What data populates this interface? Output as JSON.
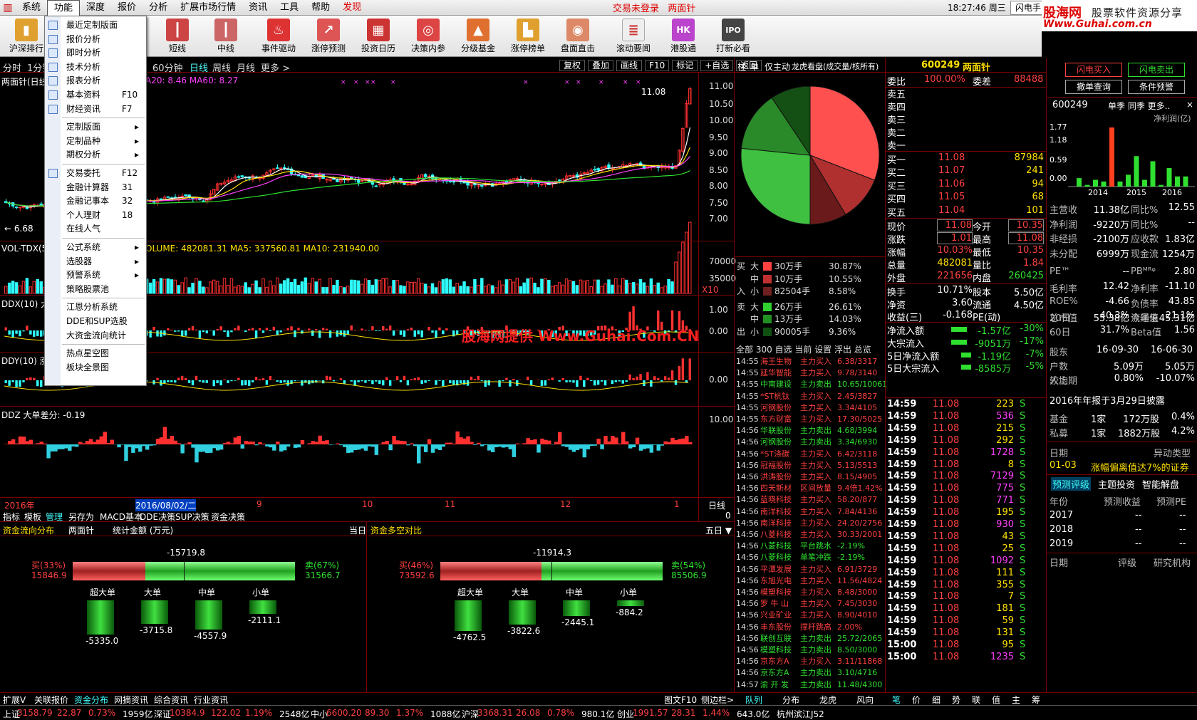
{
  "menu": [
    "系统",
    "功能",
    "深度",
    "报价",
    "分析",
    "扩展市场行情",
    "资讯",
    "工具",
    "帮助",
    "发现"
  ],
  "status_login": "交易未登录",
  "status_stock": "两面针",
  "clock": "18:27:46 周三",
  "flash_btn": "闪电手",
  "brand": {
    "a": "股海网",
    "b": "股票软件资源分享",
    "c": "Www.Guhai.com.cn"
  },
  "toolbar": [
    "沪深排行",
    "短线",
    "中线",
    "事件驱动",
    "涨停预测",
    "投资日历",
    "决策内参",
    "分级基金",
    "涨停榜单",
    "盘面直击",
    "滚动要闻",
    "港股通",
    "打新必看"
  ],
  "period_tabs": [
    "分时",
    "1分钟",
    "60分钟",
    "日线",
    "周线",
    "月线",
    "更多 >"
  ],
  "chart_tools": [
    "复权",
    "叠加",
    "画线",
    "F10",
    "标记",
    "+自选",
    "返回"
  ],
  "dropdown": {
    "items": [
      {
        "t": "最近定制版面",
        "k": "",
        "arrow": false
      },
      {
        "t": "报价分析",
        "k": "",
        "arrow": false
      },
      {
        "t": "即时分析",
        "k": "",
        "arrow": false
      },
      {
        "t": "技术分析",
        "k": "",
        "arrow": false
      },
      {
        "t": "报表分析",
        "k": "",
        "arrow": false
      },
      {
        "t": "基本资料",
        "k": "F10",
        "arrow": false
      },
      {
        "t": "财经资讯",
        "k": "F7",
        "arrow": false
      },
      {
        "t": "定制版面",
        "k": "",
        "arrow": true
      },
      {
        "t": "定制品种",
        "k": "",
        "arrow": true
      },
      {
        "t": "期权分析",
        "k": "",
        "arrow": true
      },
      {
        "t": "交易委托",
        "k": "F12",
        "arrow": false
      },
      {
        "t": "金融计算器",
        "k": "31",
        "arrow": false
      },
      {
        "t": "金融记事本",
        "k": "32",
        "arrow": false
      },
      {
        "t": "个人理财",
        "k": "18",
        "arrow": false
      },
      {
        "t": "在线人气",
        "k": "",
        "arrow": false
      },
      {
        "t": "公式系统",
        "k": "",
        "arrow": true
      },
      {
        "t": "选股器",
        "k": "",
        "arrow": true
      },
      {
        "t": "预警系统",
        "k": "",
        "arrow": true
      },
      {
        "t": "策略股票池",
        "k": "",
        "arrow": false
      },
      {
        "t": "江恩分析系统",
        "k": "",
        "arrow": false
      },
      {
        "t": "DDE和SUP选股",
        "k": "",
        "arrow": false
      },
      {
        "t": "大资金流向统计",
        "k": "",
        "arrow": false
      },
      {
        "t": "热点星空图",
        "k": "",
        "arrow": false
      },
      {
        "t": "板块全景图",
        "k": "",
        "arrow": false
      }
    ]
  },
  "chart": {
    "title_main": "两面针(日线",
    "ma_legend": "A20: 8.46  MA60: 8.27",
    "high_label": "11.08",
    "low_label": "6.68",
    "price_axis": [
      "11.00",
      "10.50",
      "10.00",
      "9.50",
      "9.00",
      "8.50",
      "8.00",
      "7.50",
      "7.00"
    ],
    "vol_title": "VOL-TDX(5",
    "vol_legend": "OLUME: 482081.31  MA5: 337560.81  MA10: 231940.00",
    "vol_axis": [
      "70000",
      "35000",
      "X10"
    ],
    "ddx_title": "DDX(10) 大",
    "ddx_axis": [
      "1.00",
      "0.00"
    ],
    "ddy_title": "DDY(10) 涨跌动因",
    "ddy_axis": [
      "0.00"
    ],
    "ddz_title": "DDZ 大单差分: -0.19",
    "ddz_axis": [
      "10.00"
    ],
    "watermark": "股海网提供 Www.Guhai.Com.CN",
    "time_axis": [
      "2016年",
      "2016/08/02/二",
      "9",
      "10",
      "11",
      "12",
      "1"
    ],
    "period_label": "日线",
    "panel_value": "0"
  },
  "indicator_tabs": [
    "指标",
    "模板",
    "管理",
    "另存为",
    "MACD基本",
    "DDE决策",
    "SUP决策",
    "资金决策"
  ],
  "bottom": {
    "left_title": "资金流向分布",
    "left_stock": "两面针",
    "left_unit": "统计金额 (万元)",
    "left_period": "当日",
    "right_title": "资金多空对比",
    "right_period": "五日 ▼",
    "left_net": "-15719.8",
    "left_buy": "买(33%)",
    "left_buy_v": "15846.9",
    "left_sell": "卖(67%)",
    "left_sell_v": "31566.7",
    "right_net": "-11914.3",
    "right_buy": "买(46%)",
    "right_buy_v": "73592.6",
    "right_sell": "卖(54%)",
    "right_sell_v": "85506.9",
    "left_bars": [
      {
        "n": "超大单",
        "v": "-5335.0"
      },
      {
        "n": "大单",
        "v": "-3715.8"
      },
      {
        "n": "中单",
        "v": "-4557.9"
      },
      {
        "n": "小单",
        "v": "-2111.1"
      }
    ],
    "right_bars": [
      {
        "n": "超大单",
        "v": "-4762.5"
      },
      {
        "n": "大单",
        "v": "-3822.6"
      },
      {
        "n": "中单",
        "v": "-2445.1"
      },
      {
        "n": "小单",
        "v": "-884.2"
      }
    ]
  },
  "pie_tabs": [
    "柱",
    "单",
    "仅主动",
    "龙虎看盘(成交量/核所有)"
  ],
  "pie_data": [
    30.87,
    10.55,
    8.58,
    26.61,
    14.03,
    9.36
  ],
  "flow": [
    {
      "side": "买",
      "size": "大",
      "amount": "30万手",
      "pct": "30.87%",
      "color": "#ff4040"
    },
    {
      "side": "",
      "size": "中",
      "amount": "10万手",
      "pct": "10.55%",
      "color": "#c03030"
    },
    {
      "side": "入",
      "size": "小",
      "amount": "82504手",
      "pct": "8.58%",
      "color": "#702020"
    },
    {
      "side": "卖",
      "size": "大",
      "amount": "26万手",
      "pct": "26.61%",
      "color": "#30d030"
    },
    {
      "side": "",
      "size": "中",
      "amount": "13万手",
      "pct": "14.03%",
      "color": "#209020"
    },
    {
      "side": "出",
      "size": "小",
      "amount": "90005手",
      "pct": "9.36%",
      "color": "#105010"
    }
  ],
  "rt_tabs": "全部  300  自选  当前  设置  浮出  总览",
  "rt_list": [
    [
      "14:55",
      "海王生物",
      "主力买入",
      "6.38/3317",
      "r"
    ],
    [
      "14:55",
      "延华智能",
      "主力买入",
      "9.78/3140",
      "r"
    ],
    [
      "14:55",
      "中南建设",
      "主力卖出",
      "10.65/10061",
      "g"
    ],
    [
      "14:55",
      "*ST杭钛",
      "主力买入",
      "2.45/3827",
      "r"
    ],
    [
      "14:55",
      "河钢股份",
      "主力买入",
      "3.34/4105",
      "r"
    ],
    [
      "14:55",
      "东方财富",
      "主力买入",
      "17.30/5025",
      "r"
    ],
    [
      "14:56",
      "华联股份",
      "主力卖出",
      "4.68/3994",
      "g"
    ],
    [
      "14:56",
      "河钢股份",
      "主力卖出",
      "3.34/6930",
      "g"
    ],
    [
      "14:56",
      "*ST涤碳",
      "主力买入",
      "6.42/3118",
      "r"
    ],
    [
      "14:56",
      "冠福股份",
      "主力买入",
      "5.13/5513",
      "r"
    ],
    [
      "14:56",
      "洪涛股份",
      "主力买入",
      "8.15/4905",
      "r"
    ],
    [
      "14:56",
      "四天新材",
      "区间放量",
      "9.4倍1.42%",
      "r"
    ],
    [
      "14:56",
      "蓝晓科技",
      "主力买入",
      "58.20/877",
      "r"
    ],
    [
      "14:56",
      "南洋科技",
      "主力买入",
      "7.84/4136",
      "r"
    ],
    [
      "14:56",
      "南洋科技",
      "主力买入",
      "24.20/2756",
      "r"
    ],
    [
      "14:56",
      "八菱科技",
      "主力买入",
      "30.33/2001",
      "r"
    ],
    [
      "14:56",
      "八菱科技",
      "平台跳水",
      "-2.19%",
      "g"
    ],
    [
      "14:56",
      "八菱科技",
      "单笔冲跌",
      "-2.19%",
      "g"
    ],
    [
      "14:56",
      "平潭发展",
      "主力买入",
      "6.91/3729",
      "r"
    ],
    [
      "14:56",
      "东旭光电",
      "主力买入",
      "11.56/4824",
      "r"
    ],
    [
      "14:56",
      "模塑科技",
      "主力买入",
      "8.48/3000",
      "r"
    ],
    [
      "14:56",
      "罗 牛 山",
      "主力买入",
      "7.45/3030",
      "r"
    ],
    [
      "14:56",
      "兴业矿业",
      "主力买入",
      "8.90/4010",
      "r"
    ],
    [
      "14:56",
      "丰东股份",
      "撑杆跳高",
      "2.00%",
      "r"
    ],
    [
      "14:56",
      "联创互联",
      "主力卖出",
      "25.72/2065",
      "g"
    ],
    [
      "14:56",
      "模塑科技",
      "主力卖出",
      "8.50/3000",
      "g"
    ],
    [
      "14:56",
      "京东方A",
      "主力买入",
      "3.11/11868",
      "r"
    ],
    [
      "14:56",
      "京东方A",
      "主力卖出",
      "3.10/4716",
      "g"
    ],
    [
      "14:57",
      "渝 开 发",
      "主力卖出",
      "11.48/4300",
      "g"
    ]
  ],
  "quote": {
    "code": "600249",
    "name": "两面针",
    "webi_l": "委比",
    "webi_v": "100.00%",
    "weicha_l": "委差",
    "weicha_v": "88488",
    "sells": [
      "卖五",
      "卖四",
      "卖三",
      "卖二",
      "卖一"
    ],
    "buys": [
      {
        "l": "买一",
        "p": "11.08",
        "v": "87984"
      },
      {
        "l": "买二",
        "p": "11.07",
        "v": "241"
      },
      {
        "l": "买三",
        "p": "11.06",
        "v": "94"
      },
      {
        "l": "买四",
        "p": "11.05",
        "v": "68"
      },
      {
        "l": "买五",
        "p": "11.04",
        "v": "101"
      }
    ],
    "stats": [
      [
        "现价",
        "11.08",
        "今开",
        "10.35"
      ],
      [
        "涨跌",
        "1.01",
        "最高",
        "11.08"
      ],
      [
        "涨幅",
        "10.03%",
        "最低",
        "10.35"
      ],
      [
        "总量",
        "482081",
        "量比",
        "1.84"
      ],
      [
        "外盘",
        "221656",
        "内盘",
        "260425"
      ]
    ],
    "stats2": [
      [
        "换手",
        "10.71%",
        "股本",
        "5.50亿"
      ],
      [
        "净资",
        "3.60",
        "流通",
        "4.50亿"
      ],
      [
        "收益(三)",
        "-0.168",
        "PE(动)",
        ""
      ]
    ],
    "netflow": [
      [
        "净流入额",
        "-1.57亿",
        "-30%"
      ],
      [
        "大宗流入",
        "-9051万",
        "-17%"
      ],
      [
        "5日净流入额",
        "-1.19亿",
        "-7%"
      ],
      [
        "5日大宗流入",
        "-8585万",
        "-5%"
      ]
    ],
    "ticks": [
      [
        "14:59",
        "11.08",
        "223",
        "S"
      ],
      [
        "14:59",
        "11.08",
        "536",
        "S"
      ],
      [
        "14:59",
        "11.08",
        "215",
        "S"
      ],
      [
        "14:59",
        "11.08",
        "292",
        "S"
      ],
      [
        "14:59",
        "11.08",
        "1728",
        "S"
      ],
      [
        "14:59",
        "11.08",
        "8",
        "S"
      ],
      [
        "14:59",
        "11.08",
        "7129",
        "S"
      ],
      [
        "14:59",
        "11.08",
        "775",
        "S"
      ],
      [
        "14:59",
        "11.08",
        "771",
        "S"
      ],
      [
        "14:59",
        "11.08",
        "195",
        "S"
      ],
      [
        "14:59",
        "11.08",
        "930",
        "S"
      ],
      [
        "14:59",
        "11.08",
        "43",
        "S"
      ],
      [
        "14:59",
        "11.08",
        "25",
        "S"
      ],
      [
        "14:59",
        "11.08",
        "1092",
        "S"
      ],
      [
        "14:59",
        "11.08",
        "111",
        "S"
      ],
      [
        "14:59",
        "11.08",
        "355",
        "S"
      ],
      [
        "14:59",
        "11.08",
        "7",
        "S"
      ],
      [
        "14:59",
        "11.08",
        "181",
        "S"
      ],
      [
        "14:59",
        "11.08",
        "59",
        "S"
      ],
      [
        "14:59",
        "11.08",
        "131",
        "S"
      ],
      [
        "15:00",
        "11.08",
        "95",
        "S"
      ],
      [
        "15:00",
        "11.08",
        "1235",
        "S"
      ]
    ]
  },
  "f10": {
    "buttons": [
      "闪电买入",
      "闪电卖出",
      "撤单查询",
      "条件预警"
    ],
    "code": "600249",
    "tabs": "单季  同季  更多..",
    "chart_unit": "净利润(亿)",
    "chart_axis": [
      "1.77",
      "1.18",
      "0.59",
      "0.00"
    ],
    "years": [
      "2014",
      "2015",
      "2016"
    ],
    "rows": [
      [
        "主营收",
        "11.38亿",
        "同比%",
        "12.55"
      ],
      [
        "净利润",
        "-9220万",
        "同比%",
        "--"
      ],
      [
        "非经损",
        "-2100万",
        "应收款",
        "1.83亿"
      ],
      [
        "未分配",
        "6999万",
        "现金流",
        "1254万"
      ],
      [
        "PE™",
        "--",
        "PBᴹᴿᵠ",
        "2.80"
      ],
      [
        "毛利率",
        "12.42",
        "净利率",
        "-11.10"
      ],
      [
        "ROE%",
        "-4.66",
        "负债率",
        "43.85"
      ],
      [
        "总市值",
        "55.38亿",
        "流通值",
        "45.31亿"
      ]
    ],
    "rows2": [
      [
        "20日",
        "40.3%",
        "今年来",
        "21.1%"
      ],
      [
        "60日",
        "31.7%",
        "Beta值",
        "1.56"
      ]
    ],
    "hold_head": [
      "股东",
      "16-09-30",
      "16-06-30"
    ],
    "hold_rows": [
      [
        "户数",
        "5.09万",
        "5.05万"
      ],
      [
        "人均",
        "0.80%",
        "-10.07%"
      ]
    ],
    "hold_last": "较上期",
    "report": "2016年年报于3月29日披露",
    "funds": [
      [
        "基金",
        "1家",
        "172万股",
        "0.4%"
      ],
      [
        "私募",
        "1家",
        "1882万股",
        "4.2%"
      ]
    ],
    "event_head": [
      "日期",
      "异动类型"
    ],
    "event": [
      "01-03",
      "涨幅偏离值达7%的证券"
    ],
    "forecast_tabs": [
      "预测评级",
      "主题投资",
      "智能解盘"
    ],
    "forecast_head": [
      "年份",
      "预测收益",
      "预测PE"
    ],
    "forecast": [
      [
        "2017",
        "--",
        "--"
      ],
      [
        "2018",
        "--",
        "--"
      ],
      [
        "2019",
        "--",
        "--"
      ]
    ],
    "rating_head": [
      "日期",
      "评级",
      "研究机构"
    ]
  },
  "tabbar": {
    "left": [
      "扩展V",
      "关联报价",
      "资金分布",
      "网摘资讯",
      "综合资讯",
      "行业资讯"
    ],
    "mid": [
      "图文F10",
      "侧边栏>"
    ],
    "right": [
      "队列",
      "分布",
      "龙虎",
      "风向"
    ],
    "far": [
      "笔",
      "价",
      "细",
      "势",
      "联",
      "值",
      "主",
      "筹"
    ]
  },
  "statusbar": [
    {
      "t": "上证",
      "c": "white"
    },
    {
      "t": "3158.79",
      "c": "red"
    },
    {
      "t": "22.87",
      "c": "red"
    },
    {
      "t": "0.73%",
      "c": "red"
    },
    {
      "t": "1959亿",
      "c": "white"
    },
    {
      "t": "深证",
      "c": "white"
    },
    {
      "t": "10384.9",
      "c": "red"
    },
    {
      "t": "122.02",
      "c": "red"
    },
    {
      "t": "1.19%",
      "c": "red"
    },
    {
      "t": "2548亿",
      "c": "white"
    },
    {
      "t": "中小",
      "c": "white"
    },
    {
      "t": "6600.20",
      "c": "red"
    },
    {
      "t": "89.30",
      "c": "red"
    },
    {
      "t": "1.37%",
      "c": "red"
    },
    {
      "t": "1088亿",
      "c": "white"
    },
    {
      "t": "沪深",
      "c": "white"
    },
    {
      "t": "3368.31",
      "c": "red"
    },
    {
      "t": "26.08",
      "c": "red"
    },
    {
      "t": "0.78%",
      "c": "red"
    },
    {
      "t": "980.1亿",
      "c": "white"
    },
    {
      "t": "创业",
      "c": "white"
    },
    {
      "t": "1991.57",
      "c": "red"
    },
    {
      "t": "28.31",
      "c": "red"
    },
    {
      "t": "1.44%",
      "c": "red"
    },
    {
      "t": "643.0亿",
      "c": "white"
    },
    {
      "t": "杭州滨江J52",
      "c": "white"
    }
  ]
}
